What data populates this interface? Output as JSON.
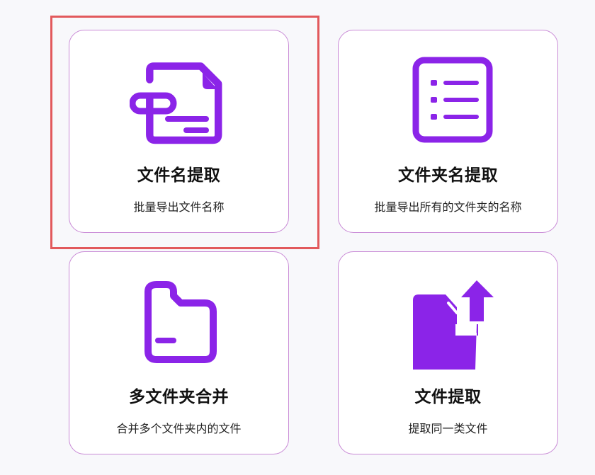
{
  "accent_color": "#8b24e8",
  "highlight_color": "#e2595c",
  "cards": [
    {
      "title": "文件名提取",
      "description": "批量导出文件名称",
      "icon": "file-document-icon"
    },
    {
      "title": "文件夹名提取",
      "description": "批量导出所有的文件夹的名称",
      "icon": "list-icon"
    },
    {
      "title": "多文件夹合并",
      "description": "合并多个文件夹内的文件",
      "icon": "folder-icon"
    },
    {
      "title": "文件提取",
      "description": "提取同一类文件",
      "icon": "folder-upload-icon"
    }
  ]
}
